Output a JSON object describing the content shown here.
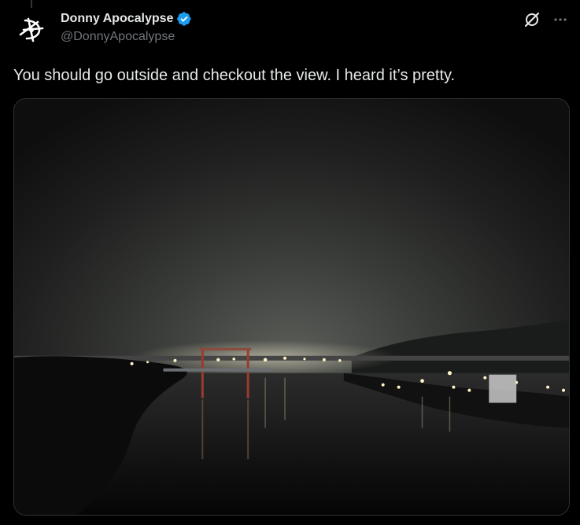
{
  "tweet": {
    "author": {
      "display_name": "Donny Apocalypse",
      "handle": "@DonnyApocalypse",
      "verified": true,
      "verified_color": "#1d9bf0"
    },
    "text": "You should go outside and checkout the view. I heard it’s pretty.",
    "media": {
      "description_icon": "photo",
      "scene": "night river with bridge and city lights"
    }
  },
  "icons": {
    "avatar": "sigil-logo",
    "grok": "grok-icon",
    "more": "more-icon"
  },
  "colors": {
    "background": "#000000",
    "text_primary": "#e7e9ea",
    "text_secondary": "#71767b",
    "border": "#2f3336"
  }
}
